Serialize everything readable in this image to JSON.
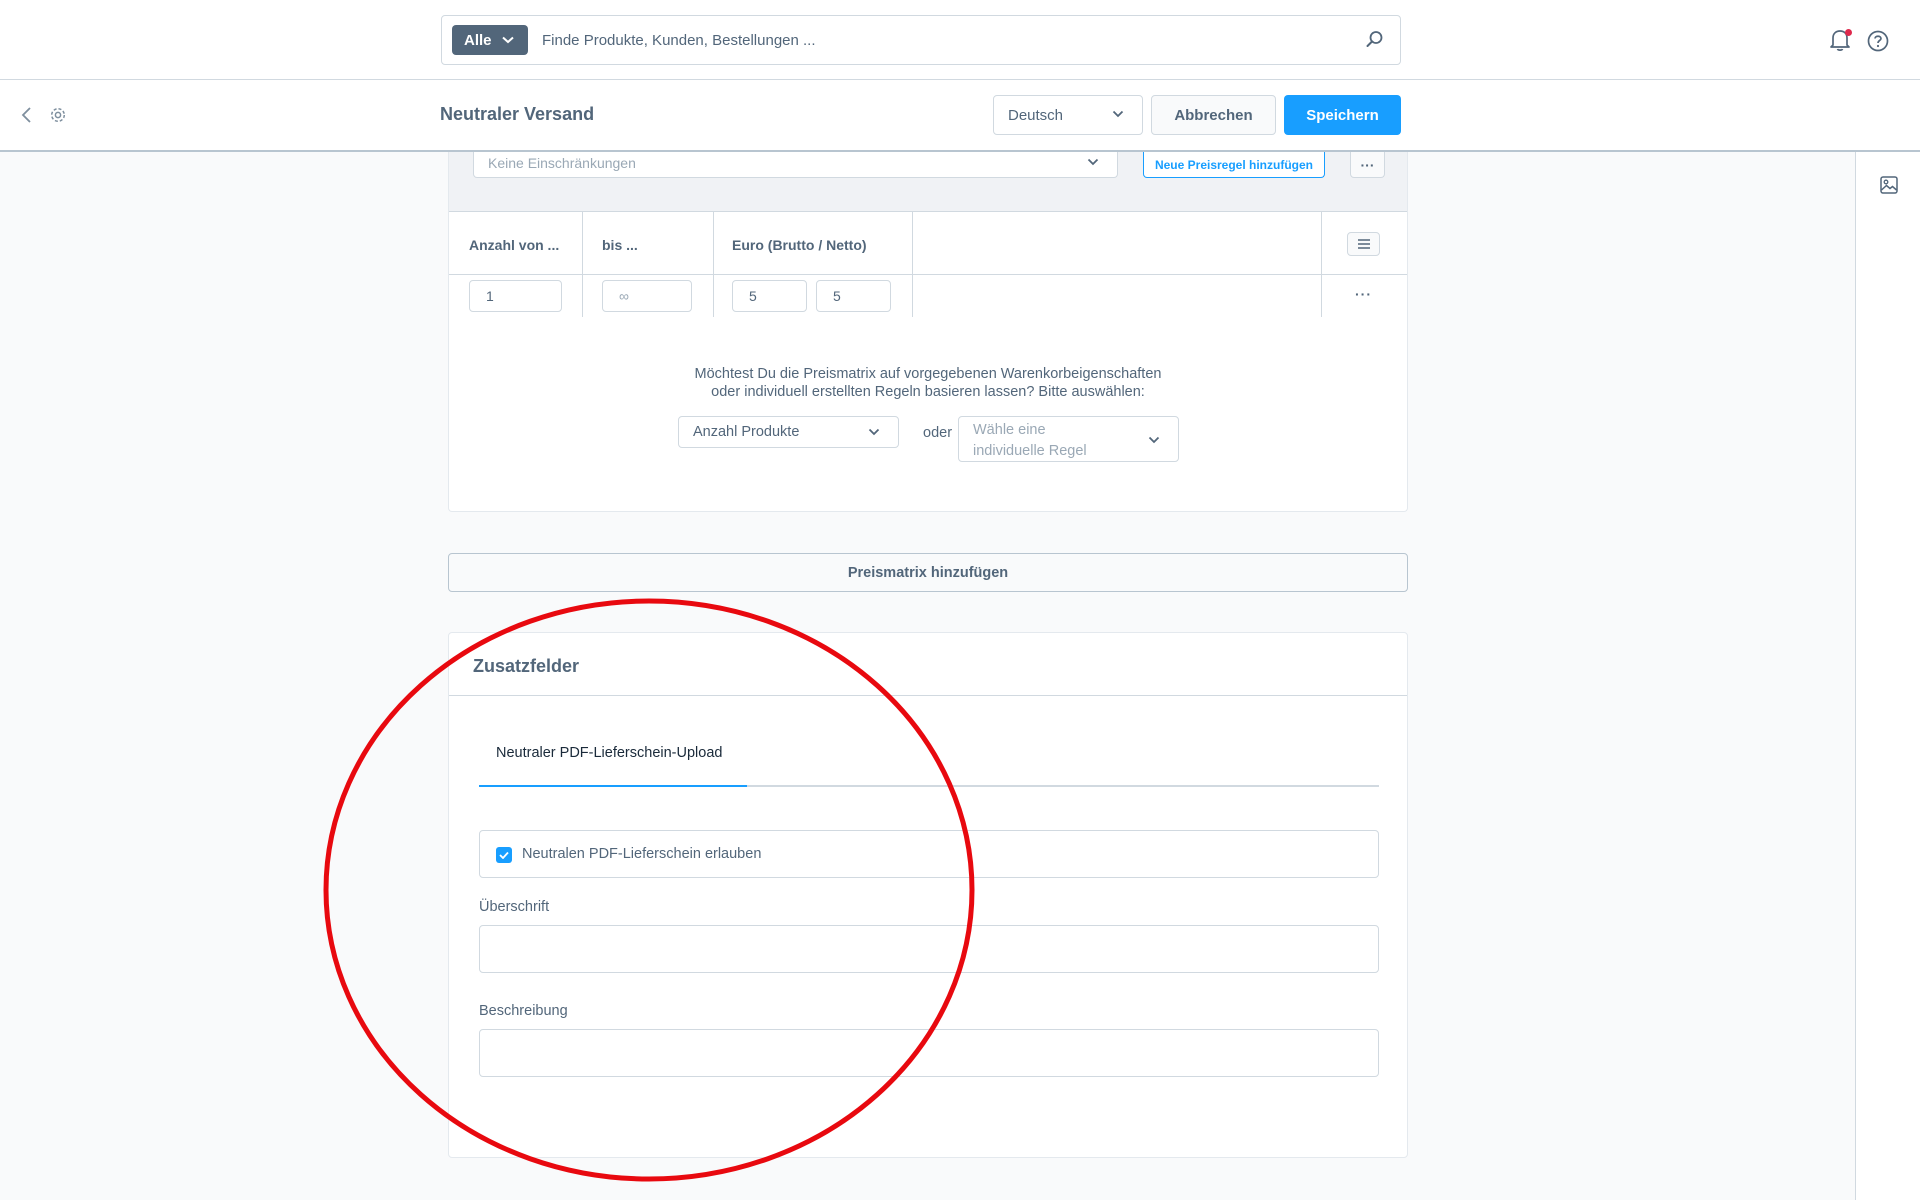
{
  "search": {
    "type_label": "Alle",
    "placeholder": "Finde Produkte, Kunden, Bestellungen ..."
  },
  "header": {
    "title": "Neutraler Versand",
    "language": "Deutsch",
    "cancel_label": "Abbrechen",
    "save_label": "Speichern"
  },
  "matrix": {
    "rule_placeholder": "Keine Einschränkungen",
    "new_rule_label": "Neue Preisregel hinzufügen",
    "more_label": "···",
    "columns": [
      "Anzahl von ...",
      "bis ...",
      "Euro (Brutto / Netto)"
    ],
    "row": {
      "from": "1",
      "to": "∞",
      "gross": "5",
      "net": "5",
      "more_label": "···"
    },
    "question_line1": "Möchtest Du die Preismatrix auf vorgegebenen Warenkorbeigenschaften",
    "question_line2": "oder individuell erstellten Regeln basieren lassen? Bitte auswählen:",
    "property_select": "Anzahl Produkte",
    "or_label": "oder",
    "custom_rule_placeholder": "Wähle eine individuelle Regel"
  },
  "add_matrix_label": "Preismatrix hinzufügen",
  "extra_fields": {
    "title": "Zusatzfelder",
    "tab_label": "Neutraler PDF-Lieferschein-Upload",
    "checkbox_label": "Neutralen PDF-Lieferschein erlauben",
    "checkbox_checked": true,
    "heading_label": "Überschrift",
    "heading_value": "",
    "description_label": "Beschreibung",
    "description_value": ""
  },
  "colors": {
    "primary": "#189eff",
    "text": "#52667a",
    "annotation": "#e8090f",
    "notification": "#de294c"
  },
  "icons": [
    "search-icon",
    "bell-icon",
    "help-icon",
    "back-icon",
    "cog-icon",
    "chevron-down-icon",
    "image-icon",
    "list-icon",
    "check-icon"
  ]
}
